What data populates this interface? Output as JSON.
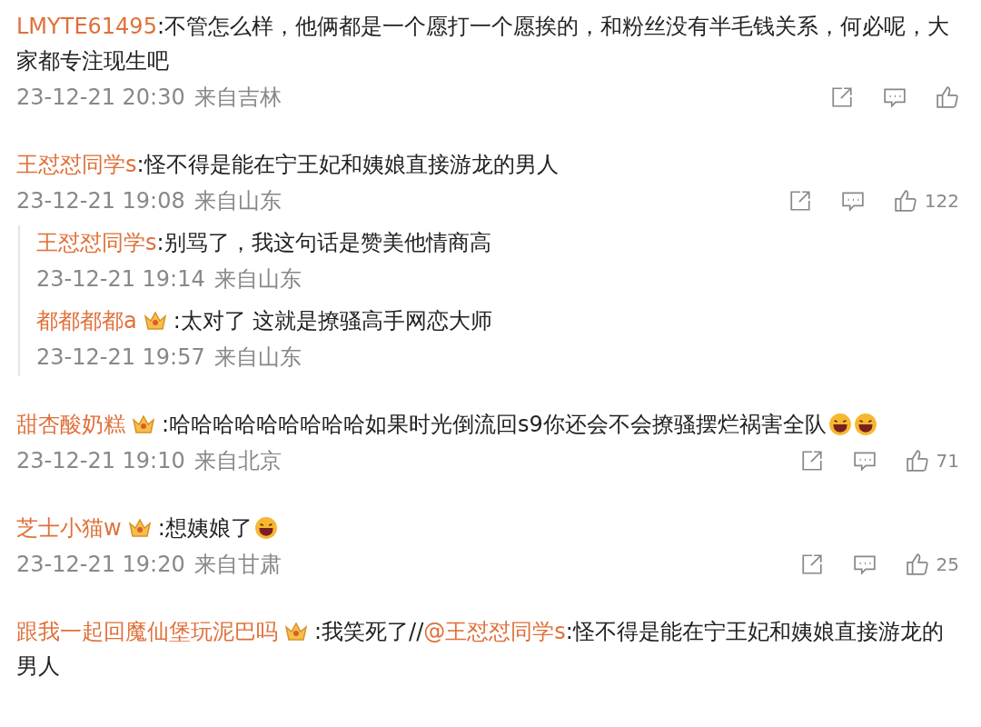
{
  "comments": [
    {
      "user": "LMYTE61495",
      "badge": false,
      "segments": [
        {
          "kind": "text",
          "text": ":不管怎么样，他俩都是一个愿打一个愿挨的，和粉丝没有半毛钱关系，何必呢，大家都专注现生吧"
        }
      ],
      "time": "23-12-21 20:30",
      "location": "来自吉林",
      "actions": true
    },
    {
      "user": "王怼怼同学s",
      "badge": false,
      "segments": [
        {
          "kind": "text",
          "text": ":怪不得是能在宁王妃和姨娘直接游龙的男人"
        }
      ],
      "time": "23-12-21 19:08",
      "location": "来自山东",
      "actions": true,
      "likes": "122",
      "replies": [
        {
          "user": "王怼怼同学s",
          "badge": false,
          "segments": [
            {
              "kind": "text",
              "text": ":别骂了，我这句话是赞美他情商高"
            }
          ],
          "time": "23-12-21 19:14",
          "location": "来自山东"
        },
        {
          "user": "都都都都a",
          "badge": true,
          "segments": [
            {
              "kind": "text",
              "text": ":太对了 这就是撩骚高手网恋大师"
            }
          ],
          "time": "23-12-21 19:57",
          "location": "来自山东"
        }
      ]
    },
    {
      "user": "甜杏酸奶糕",
      "badge": true,
      "segments": [
        {
          "kind": "text",
          "text": ":哈哈哈哈哈哈哈哈哈如果时光倒流回s9你还会不会撩骚摆烂祸害全队"
        },
        {
          "kind": "emoji"
        },
        {
          "kind": "emoji"
        }
      ],
      "time": "23-12-21 19:10",
      "location": "来自北京",
      "actions": true,
      "likes": "71"
    },
    {
      "user": "芝士小猫w",
      "badge": true,
      "segments": [
        {
          "kind": "text",
          "text": ":想姨娘了"
        },
        {
          "kind": "emoji"
        }
      ],
      "time": "23-12-21 19:20",
      "location": "来自甘肃",
      "actions": true,
      "likes": "25"
    },
    {
      "user": "跟我一起回魔仙堡玩泥巴吗",
      "badge": true,
      "segments": [
        {
          "kind": "text",
          "text": ":我笑死了//"
        },
        {
          "kind": "mention",
          "text": "@王怼怼同学s"
        },
        {
          "kind": "text",
          "text": ":怪不得是能在宁王妃和姨娘直接游龙的男人"
        }
      ]
    }
  ]
}
